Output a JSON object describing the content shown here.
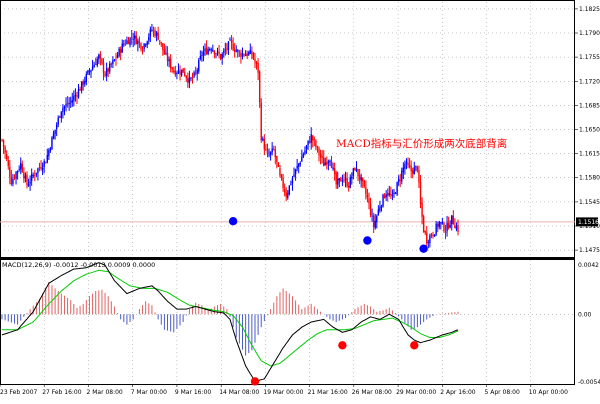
{
  "annotation": "MACD指标与汇价形成两次底部背离",
  "macd_title": "MACD(12,26,9) -0.0012 -0.0013 0.0009 0.0000",
  "colors": {
    "bull": "#0000ff",
    "bear": "#ff0000",
    "macd_line": "#000000",
    "signal_line": "#00cc00",
    "hist_up": "#e06060",
    "hist_down": "#4a5cc8",
    "pivot_price": "#0000ff",
    "pivot_macd": "#ff0000",
    "current_line": "#e8b0b0",
    "grid": "#000000"
  },
  "price_axis": {
    "ticks": [
      "1.1825",
      "1.1790",
      "1.1755",
      "1.1720",
      "1.1685",
      "1.1650",
      "1.1615",
      "1.1580",
      "1.1545",
      "1.1510",
      "1.1475"
    ],
    "current": "1.1516"
  },
  "macd_axis": {
    "ticks": [
      "0.0042",
      "0.00",
      "-0.0054"
    ]
  },
  "time_axis": {
    "ticks": [
      "23 Feb 2007",
      "27 Feb 16:00",
      "2 Mar 08:00",
      "7 Mar 00:00",
      "9 Mar 16:00",
      "14 Mar 08:00",
      "19 Mar 00:00",
      "21 Mar 16:00",
      "26 Mar 08:00",
      "29 Mar 00:00",
      "2 Apr 16:00",
      "5 Apr 08:00",
      "10 Apr 00:00"
    ]
  },
  "chart_data": [
    {
      "type": "candlestick",
      "title": "",
      "ylim": [
        1.1465,
        1.1835
      ],
      "x_range": [
        "23 Feb 2007",
        "10 Apr 2007"
      ],
      "waypoints_close": [
        [
          0,
          1.1635
        ],
        [
          6,
          1.1575
        ],
        [
          12,
          1.16
        ],
        [
          16,
          1.157
        ],
        [
          22,
          1.159
        ],
        [
          28,
          1.1605
        ],
        [
          34,
          1.165
        ],
        [
          38,
          1.168
        ],
        [
          44,
          1.169
        ],
        [
          50,
          1.171
        ],
        [
          56,
          1.1735
        ],
        [
          62,
          1.1755
        ],
        [
          66,
          1.173
        ],
        [
          72,
          1.175
        ],
        [
          78,
          1.1775
        ],
        [
          84,
          1.1785
        ],
        [
          90,
          1.177
        ],
        [
          96,
          1.1795
        ],
        [
          100,
          1.1785
        ],
        [
          104,
          1.176
        ],
        [
          110,
          1.1735
        ],
        [
          116,
          1.1735
        ],
        [
          120,
          1.172
        ],
        [
          124,
          1.173
        ],
        [
          128,
          1.176
        ],
        [
          134,
          1.177
        ],
        [
          140,
          1.1755
        ],
        [
          146,
          1.1775
        ],
        [
          152,
          1.176
        ],
        [
          156,
          1.176
        ],
        [
          160,
          1.176
        ],
        [
          164,
          1.1735
        ],
        [
          166,
          1.164
        ],
        [
          170,
          1.161
        ],
        [
          174,
          1.162
        ],
        [
          178,
          1.158
        ],
        [
          182,
          1.1555
        ],
        [
          186,
          1.158
        ],
        [
          190,
          1.16
        ],
        [
          194,
          1.162
        ],
        [
          198,
          1.164
        ],
        [
          202,
          1.162
        ],
        [
          206,
          1.16
        ],
        [
          210,
          1.161
        ],
        [
          214,
          1.157
        ],
        [
          218,
          1.158
        ],
        [
          222,
          1.157
        ],
        [
          226,
          1.1595
        ],
        [
          230,
          1.1575
        ],
        [
          234,
          1.155
        ],
        [
          238,
          1.151
        ],
        [
          242,
          1.154
        ],
        [
          246,
          1.156
        ],
        [
          250,
          1.155
        ],
        [
          254,
          1.1575
        ],
        [
          258,
          1.16
        ],
        [
          262,
          1.159
        ],
        [
          266,
          1.1595
        ],
        [
          268,
          1.154
        ],
        [
          270,
          1.1505
        ],
        [
          272,
          1.149
        ],
        [
          276,
          1.15
        ],
        [
          280,
          1.1515
        ],
        [
          284,
          1.1505
        ],
        [
          288,
          1.152
        ],
        [
          292,
          1.1505
        ]
      ],
      "bar_count": 293
    },
    {
      "type": "macd",
      "title": "MACD(12,26,9)",
      "ylim": [
        -0.0054,
        0.0042
      ],
      "hist_waypoints": [
        [
          0,
          -0.0004
        ],
        [
          10,
          -0.0008
        ],
        [
          18,
          0.0004
        ],
        [
          24,
          0.0012
        ],
        [
          30,
          0.0025
        ],
        [
          34,
          0.002
        ],
        [
          38,
          0.0016
        ],
        [
          44,
          0.0011
        ],
        [
          48,
          0.0005
        ],
        [
          52,
          0.0008
        ],
        [
          56,
          0.0014
        ],
        [
          60,
          0.0018
        ],
        [
          64,
          0.0019
        ],
        [
          68,
          0.0014
        ],
        [
          72,
          0.0006
        ],
        [
          76,
          -0.0004
        ],
        [
          80,
          -0.0008
        ],
        [
          84,
          -0.0004
        ],
        [
          88,
          0.0004
        ],
        [
          92,
          0.001
        ],
        [
          96,
          0.0007
        ],
        [
          100,
          -0.0004
        ],
        [
          104,
          -0.0012
        ],
        [
          110,
          -0.0014
        ],
        [
          116,
          -0.0006
        ],
        [
          120,
          0.0004
        ],
        [
          124,
          0.0009
        ],
        [
          128,
          0.0007
        ],
        [
          132,
          0.0003
        ],
        [
          136,
          0.0006
        ],
        [
          140,
          0.0008
        ],
        [
          144,
          0.0004
        ],
        [
          146,
          -0.0002
        ],
        [
          150,
          -0.0018
        ],
        [
          156,
          -0.0032
        ],
        [
          160,
          -0.0028
        ],
        [
          166,
          -0.001
        ],
        [
          172,
          0.0004
        ],
        [
          176,
          0.0014
        ],
        [
          180,
          0.002
        ],
        [
          186,
          0.0014
        ],
        [
          192,
          0.0004
        ],
        [
          198,
          0.0008
        ],
        [
          204,
          0.0002
        ],
        [
          210,
          -0.0004
        ],
        [
          214,
          -0.0006
        ],
        [
          220,
          -0.0003
        ],
        [
          226,
          0.0004
        ],
        [
          232,
          0.0008
        ],
        [
          236,
          0.0006
        ],
        [
          240,
          0.0002
        ],
        [
          244,
          0.0003
        ],
        [
          248,
          0.0005
        ],
        [
          252,
          0.0001
        ],
        [
          256,
          -0.0004
        ],
        [
          262,
          -0.0012
        ],
        [
          266,
          -0.001
        ],
        [
          272,
          -0.0004
        ],
        [
          278,
          0.0
        ],
        [
          286,
          0.0001
        ],
        [
          292,
          0.0002
        ]
      ],
      "macd_waypoints": [
        [
          0,
          -0.0016
        ],
        [
          10,
          -0.0012
        ],
        [
          20,
          0.0002
        ],
        [
          30,
          0.0024
        ],
        [
          38,
          0.003
        ],
        [
          46,
          0.0035
        ],
        [
          54,
          0.0036
        ],
        [
          62,
          0.004
        ],
        [
          66,
          0.0038
        ],
        [
          72,
          0.0026
        ],
        [
          80,
          0.0016
        ],
        [
          88,
          0.002
        ],
        [
          96,
          0.0022
        ],
        [
          100,
          0.0018
        ],
        [
          106,
          0.001
        ],
        [
          112,
          0.0004
        ],
        [
          118,
          0.0004
        ],
        [
          124,
          0.0006
        ],
        [
          130,
          0.0004
        ],
        [
          136,
          0.0002
        ],
        [
          142,
          0.0001
        ],
        [
          146,
          -0.0004
        ],
        [
          150,
          -0.002
        ],
        [
          156,
          -0.004
        ],
        [
          162,
          -0.0052
        ],
        [
          168,
          -0.005
        ],
        [
          174,
          -0.0038
        ],
        [
          180,
          -0.0026
        ],
        [
          186,
          -0.0016
        ],
        [
          192,
          -0.001
        ],
        [
          198,
          -0.0006
        ],
        [
          206,
          -0.0004
        ],
        [
          212,
          -0.001
        ],
        [
          218,
          -0.0014
        ],
        [
          224,
          -0.0012
        ],
        [
          230,
          -0.0006
        ],
        [
          236,
          -0.0002
        ],
        [
          242,
          -0.0004
        ],
        [
          248,
          0.0
        ],
        [
          254,
          -0.0004
        ],
        [
          260,
          -0.0016
        ],
        [
          264,
          -0.002
        ],
        [
          268,
          -0.0022
        ],
        [
          274,
          -0.002
        ],
        [
          282,
          -0.0016
        ],
        [
          288,
          -0.0014
        ],
        [
          292,
          -0.0012
        ]
      ],
      "signal_waypoints": [
        [
          0,
          -0.0012
        ],
        [
          10,
          -0.0012
        ],
        [
          20,
          -0.0006
        ],
        [
          30,
          0.0008
        ],
        [
          38,
          0.0018
        ],
        [
          46,
          0.0026
        ],
        [
          54,
          0.0031
        ],
        [
          62,
          0.0034
        ],
        [
          68,
          0.0033
        ],
        [
          74,
          0.0028
        ],
        [
          82,
          0.0022
        ],
        [
          90,
          0.002
        ],
        [
          98,
          0.002
        ],
        [
          106,
          0.0017
        ],
        [
          114,
          0.0011
        ],
        [
          120,
          0.0007
        ],
        [
          128,
          0.0005
        ],
        [
          136,
          0.0003
        ],
        [
          142,
          0.0002
        ],
        [
          148,
          -0.0001
        ],
        [
          154,
          -0.001
        ],
        [
          160,
          -0.0024
        ],
        [
          166,
          -0.0036
        ],
        [
          172,
          -0.004
        ],
        [
          178,
          -0.0038
        ],
        [
          184,
          -0.0032
        ],
        [
          190,
          -0.0026
        ],
        [
          196,
          -0.002
        ],
        [
          202,
          -0.0015
        ],
        [
          208,
          -0.0012
        ],
        [
          214,
          -0.0012
        ],
        [
          220,
          -0.0012
        ],
        [
          226,
          -0.0011
        ],
        [
          232,
          -0.0008
        ],
        [
          238,
          -0.0005
        ],
        [
          244,
          -0.0004
        ],
        [
          250,
          -0.0003
        ],
        [
          256,
          -0.0006
        ],
        [
          262,
          -0.001
        ],
        [
          268,
          -0.0015
        ],
        [
          274,
          -0.0018
        ],
        [
          280,
          -0.0018
        ],
        [
          286,
          -0.0016
        ],
        [
          292,
          -0.0013
        ]
      ]
    }
  ],
  "divergence_markers": {
    "price_points": [
      [
        148,
        1.1517
      ],
      [
        234,
        1.1489
      ],
      [
        270,
        1.1477
      ]
    ],
    "macd_points": [
      [
        162,
        -0.0052
      ],
      [
        218,
        -0.0024
      ],
      [
        264,
        -0.0024
      ]
    ]
  }
}
